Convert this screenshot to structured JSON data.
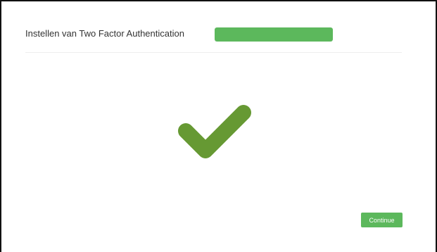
{
  "header": {
    "title": "Instellen van Two Factor Authentication",
    "progress_percent": 100
  },
  "status": {
    "icon": "checkmark-icon",
    "icon_color": "#669933"
  },
  "footer": {
    "continue_label": "Continue"
  },
  "colors": {
    "accent": "#5cb85c",
    "check": "#669933"
  }
}
